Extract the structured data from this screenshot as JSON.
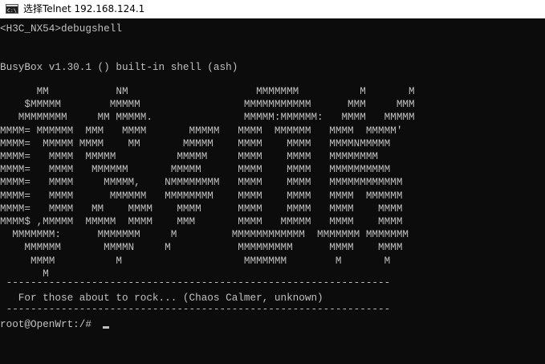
{
  "window": {
    "title": "选择Telnet 192.168.124.1",
    "icon": "console-icon",
    "background": "#0c0c0c",
    "foreground": "#c0c0c0"
  },
  "terminal": {
    "prompt_line": "<H3C_NX54>debugshell",
    "busybox_line": "BusyBox v1.30.1 () built-in shell (ash)",
    "banner_art": "      MM           NM                     MMMMMMM          M       M\n    $MMMMM        MMMMM                 MMMMMMMMMMM      MMM     MMM\n   MMMMMMMM     MM MMMMM.               MMMMM:MMMMMM:   MMMM   MMMMM\nMMMM= MMMMMM  MMM   MMMM       MMMMM   MMMM  MMMMMM   MMMM  MMMMM'\nMMMM=  MMMMM MMMM    MM       MMMMM    MMMM    MMMM   MMMMNMMMMM\nMMMM=   MMMM  MMMMM          MMMMM     MMMM    MMMM   MMMMMMMM\nMMMM=   MMMM   MMMMMM       MMMMM      MMMM    MMMM   MMMMMMMMMM\nMMMM=   MMMM     MMMMM,    NMMMMMMMM   MMMM    MMMM   MMMMMMMMMMMM\nMMMM=   MMMM      MMMMMM   MMMMMMMM    MMMM    MMMM   MMMM  MMMMMM\nMMMM=   MMMM   MM    MMMM    MMMM      MMMM    MMMM   MMMM    MMMM\nMMMM$ ,MMMMM  MMMMM  MMMM    MMM       MMMM   MMMMM   MMMM    MMMM\n  MMMMMMM:      MMMMMMM     M         MMMMMMMMMMMM  MMMMMMM MMMMMMM\n    MMMMMM       MMMMN     M           MMMMMMMMM      MMMM    MMMM\n     MMMM          M                    MMMMMMM        M       M\n       M",
    "divider_top": " ---------------------------------------------------------------",
    "tagline": "   For those about to rock... (Chaos Calmer, unknown)",
    "divider_bottom": " ---------------------------------------------------------------",
    "shell_prompt": "root@OpenWrt:/#"
  }
}
